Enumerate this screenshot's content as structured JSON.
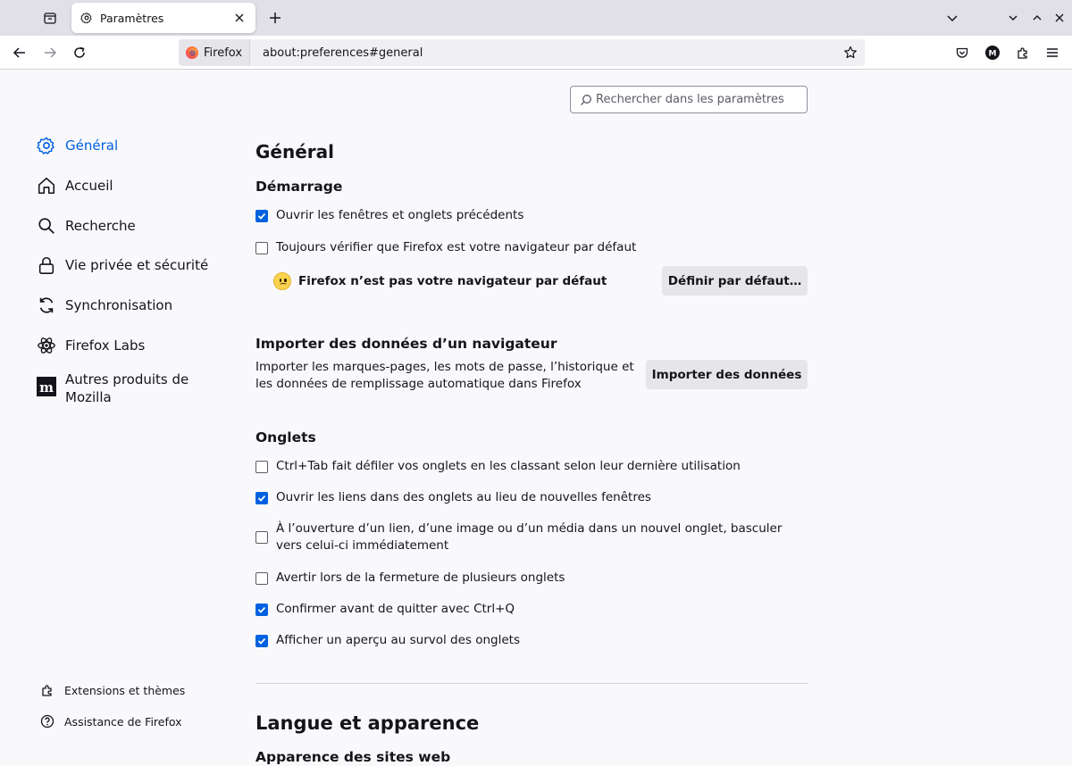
{
  "tabstrip": {
    "tab_title": "Paramètres",
    "icons": {
      "tab_list": "tab-list-icon",
      "settings": "gear-icon",
      "close": "close-icon",
      "new_tab": "plus-icon",
      "list_all": "chevron-down-icon",
      "minimize": "chevron-down-icon",
      "maximize": "chevron-up-icon",
      "close_window": "close-icon"
    }
  },
  "navbar": {
    "identity_label": "Firefox",
    "url": "about:preferences#general",
    "icons": {
      "back": "arrow-left-icon",
      "forward": "arrow-right-icon",
      "reload": "reload-icon",
      "bookmark": "star-icon",
      "pocket": "pocket-icon",
      "account": "account-icon",
      "account_letter": "M",
      "extensions": "puzzle-icon",
      "menu": "hamburger-menu-icon"
    }
  },
  "search": {
    "placeholder": "Rechercher dans les paramètres"
  },
  "sidebar": {
    "items": [
      {
        "label": "Général",
        "icon": "gear-icon",
        "active": true
      },
      {
        "label": "Accueil",
        "icon": "home-icon"
      },
      {
        "label": "Recherche",
        "icon": "search-icon"
      },
      {
        "label": "Vie privée et sécurité",
        "icon": "lock-icon"
      },
      {
        "label": "Synchronisation",
        "icon": "sync-icon"
      },
      {
        "label": "Firefox Labs",
        "icon": "labs-icon"
      },
      {
        "label": "Autres produits de Mozilla",
        "icon": "mozilla-icon"
      }
    ],
    "footer": [
      {
        "label": "Extensions et thèmes",
        "icon": "puzzle-icon"
      },
      {
        "label": "Assistance de Firefox",
        "icon": "help-icon"
      }
    ]
  },
  "main": {
    "title": "Général",
    "startup": {
      "heading": "Démarrage",
      "restore_session": {
        "label": "Ouvrir les fenêtres et onglets précédents",
        "checked": true
      },
      "check_default": {
        "label": "Toujours vérifier que Firefox est votre navigateur par défaut",
        "checked": false
      },
      "not_default_text": "Firefox n’est pas votre navigateur par défaut",
      "set_default_button": "Définir par défaut…",
      "status_icon": "sad-face-icon"
    },
    "import": {
      "heading": "Importer des données d’un navigateur",
      "description": "Importer les marques-pages, les mots de passe, l’historique et les données de remplissage automatique dans Firefox",
      "button": "Importer des données"
    },
    "tabs": {
      "heading": "Onglets",
      "options": [
        {
          "label": "Ctrl+Tab fait défiler vos onglets en les classant selon leur dernière utilisation",
          "checked": false
        },
        {
          "label": "Ouvrir les liens dans des onglets au lieu de nouvelles fenêtres",
          "checked": true
        },
        {
          "label": "À l’ouverture d’un lien, d’une image ou d’un média dans un nouvel onglet, basculer vers celui-ci immédiatement",
          "checked": false
        },
        {
          "label": "Avertir lors de la fermeture de plusieurs onglets",
          "checked": false
        },
        {
          "label": "Confirmer avant de quitter avec Ctrl+Q",
          "checked": true
        },
        {
          "label": "Afficher un aperçu au survol des onglets",
          "checked": true
        }
      ]
    },
    "language": {
      "heading": "Langue et apparence",
      "subheading": "Apparence des sites web"
    }
  },
  "colors": {
    "accent": "#0061e0",
    "tabstrip_bg": "#e0e0e6",
    "page_bg": "#f9f9fb",
    "button_bg": "#e6e6ea"
  }
}
